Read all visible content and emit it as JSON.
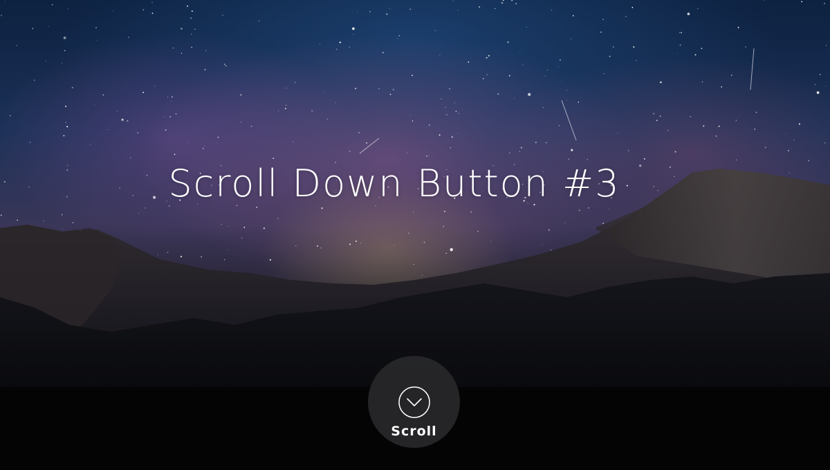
{
  "hero": {
    "title": "Scroll Down Button #3"
  },
  "scroll_button": {
    "label": "Scroll",
    "icon": "chevron-down-circle-icon"
  },
  "colors": {
    "button_bg": "#28282a",
    "text": "#ffffff"
  }
}
